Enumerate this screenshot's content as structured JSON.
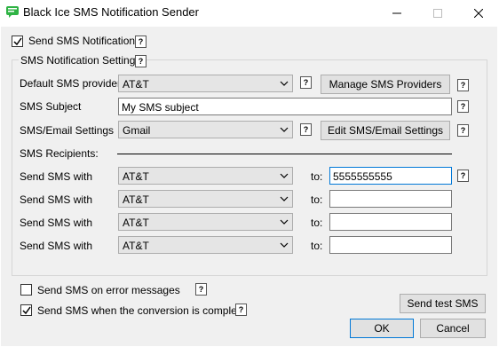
{
  "window": {
    "title": "Black Ice SMS Notification Sender"
  },
  "colors": {
    "accent": "#0078d7",
    "icon": "#2fb344",
    "dialog_bg": "#f0f0f0"
  },
  "send_sms_notification": {
    "label": "Send SMS Notification",
    "checked": true
  },
  "help_glyph": "?",
  "group": {
    "title": "SMS Notification Settings"
  },
  "default_provider": {
    "label": "Default SMS provider",
    "value": "AT&T"
  },
  "manage_button": "Manage SMS Providers",
  "subject": {
    "label": "SMS Subject",
    "value": "My SMS subject"
  },
  "email_settings": {
    "label": "SMS/Email Settings",
    "value": "Gmail"
  },
  "edit_button": "Edit SMS/Email Settings",
  "recipients_label": "SMS Recipients:",
  "recipients": [
    {
      "label": "Send SMS with",
      "provider": "AT&T",
      "to_label": "to:",
      "to_value": "5555555555"
    },
    {
      "label": "Send SMS with",
      "provider": "AT&T",
      "to_label": "to:",
      "to_value": ""
    },
    {
      "label": "Send SMS with",
      "provider": "AT&T",
      "to_label": "to:",
      "to_value": ""
    },
    {
      "label": "Send SMS with",
      "provider": "AT&T",
      "to_label": "to:",
      "to_value": ""
    }
  ],
  "on_error": {
    "label": "Send SMS on error messages",
    "checked": false
  },
  "on_complete": {
    "label": "Send SMS when the conversion is complete",
    "checked": true
  },
  "buttons": {
    "test": "Send test SMS",
    "ok": "OK",
    "cancel": "Cancel"
  }
}
